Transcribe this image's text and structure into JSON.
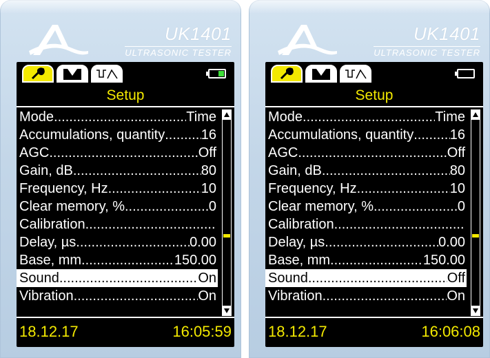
{
  "brand": {
    "model": "UK1401",
    "subtitle": "ULTRASONIC TESTER"
  },
  "colors": {
    "screen_bg": "#000000",
    "accent_yellow": "#f3e900",
    "battery_green": "#3fe03a",
    "device_body": "#c3d6e8"
  },
  "tabs": [
    {
      "icon": "wrench-icon",
      "active": true
    },
    {
      "icon": "waveform-icon",
      "active": false
    },
    {
      "icon": "signal-trace-icon",
      "active": false
    }
  ],
  "screens": [
    {
      "title": "Setup",
      "battery_level": 0.35,
      "items": [
        {
          "label": "Mode",
          "value": "Time",
          "selected": false
        },
        {
          "label": "Accumulations, quantity",
          "value": "16",
          "selected": false
        },
        {
          "label": "AGC",
          "value": "Off",
          "selected": false
        },
        {
          "label": "Gain, dB",
          "value": "80",
          "selected": false
        },
        {
          "label": "Frequency, Hz",
          "value": "10",
          "selected": false
        },
        {
          "label": "Clear memory, %",
          "value": "0",
          "selected": false
        },
        {
          "label": "Calibration",
          "value": "",
          "selected": false
        },
        {
          "label": "Delay, µs",
          "value": "0.00",
          "selected": false
        },
        {
          "label": "Base, mm",
          "value": "150.00",
          "selected": false
        },
        {
          "label": "Sound",
          "value": "On",
          "selected": true
        },
        {
          "label": "Vibration",
          "value": "On",
          "selected": false
        }
      ],
      "date": "18.12.17",
      "time": "16:05:59"
    },
    {
      "title": "Setup",
      "battery_level": 0.0,
      "items": [
        {
          "label": "Mode",
          "value": "Time",
          "selected": false
        },
        {
          "label": "Accumulations, quantity",
          "value": "16",
          "selected": false
        },
        {
          "label": "AGC",
          "value": "Off",
          "selected": false
        },
        {
          "label": "Gain, dB",
          "value": "80",
          "selected": false
        },
        {
          "label": "Frequency, Hz",
          "value": "10",
          "selected": false
        },
        {
          "label": "Clear memory, %",
          "value": "0",
          "selected": false
        },
        {
          "label": "Calibration",
          "value": "",
          "selected": false
        },
        {
          "label": "Delay, µs",
          "value": "0.00",
          "selected": false
        },
        {
          "label": "Base, mm",
          "value": "150.00",
          "selected": false
        },
        {
          "label": "Sound",
          "value": "Off",
          "selected": true
        },
        {
          "label": "Vibration",
          "value": "On",
          "selected": false
        }
      ],
      "date": "18.12.17",
      "time": "16:06:08"
    }
  ]
}
